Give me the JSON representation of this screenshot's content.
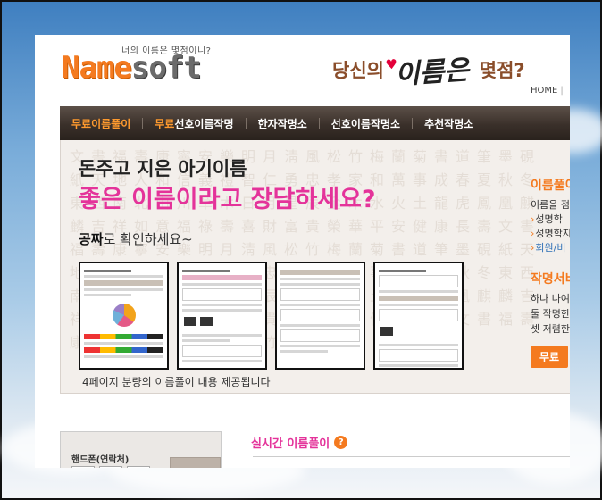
{
  "header": {
    "logo_tagline": "너의 이름은 몇점이니?",
    "logo_name": "Name",
    "logo_soft": "soft",
    "slogan_part1": "당신의",
    "slogan_brush": "이름은",
    "slogan_part2": "몇점?",
    "top_link_home": "HOME"
  },
  "nav": {
    "items": [
      {
        "label": "무료이름풀이"
      },
      {
        "highlight": "무료",
        "label": "선호이름작명"
      },
      {
        "label": "한자작명소"
      },
      {
        "label": "선호이름작명소"
      },
      {
        "label": "추천작명소"
      }
    ]
  },
  "hero": {
    "calligraphy": "文書福壽康寧安樂明月淸風松竹梅蘭菊書道筆墨硯紙天地人和信義禮智仁勇忠孝家和萬事成春夏秋冬東西南北山川草木日月星辰金木水火土龍虎鳳凰麒麟吉祥如意福祿壽喜財富貴榮華平安健康長壽文書福壽康寧安樂明月淸風松竹梅蘭菊書道筆墨硯紙天地人和信義禮智仁勇忠孝家和萬事成春夏秋冬東西南北山川草木日月星辰金木水火土龍虎鳳凰麒麟吉祥如意福祿壽喜財富貴榮華平安健康長壽文書福壽康寧安樂明月淸風松竹梅蘭菊",
    "headline1": "돈주고 지은 아기이름",
    "headline2": "좋은 이름이라고 장담하세요?",
    "sub_bold": "공짜",
    "sub_rest": "로 확인하세요~",
    "caption": "4페이지 분량의 이름풀이 내용 제공됩니다"
  },
  "right_panel": {
    "title1": "이름풀이",
    "line1": "이름을 점",
    "bullet1": "성명학",
    "bullet2": "성명학지",
    "bullet3": "회원/비",
    "title2": "작명서비",
    "line2": "하나 나여",
    "line3": "둘 작명한",
    "line4": "셋 저렴한",
    "button": "무료"
  },
  "bottom": {
    "phone_label": "핸드폰(연락처)",
    "realtime_title": "실시간 이름풀이",
    "help_icon": "?"
  },
  "colors": {
    "brand_orange": "#f47a1f",
    "headline_pink": "#e4339a",
    "nav_dark": "#3a302a"
  }
}
